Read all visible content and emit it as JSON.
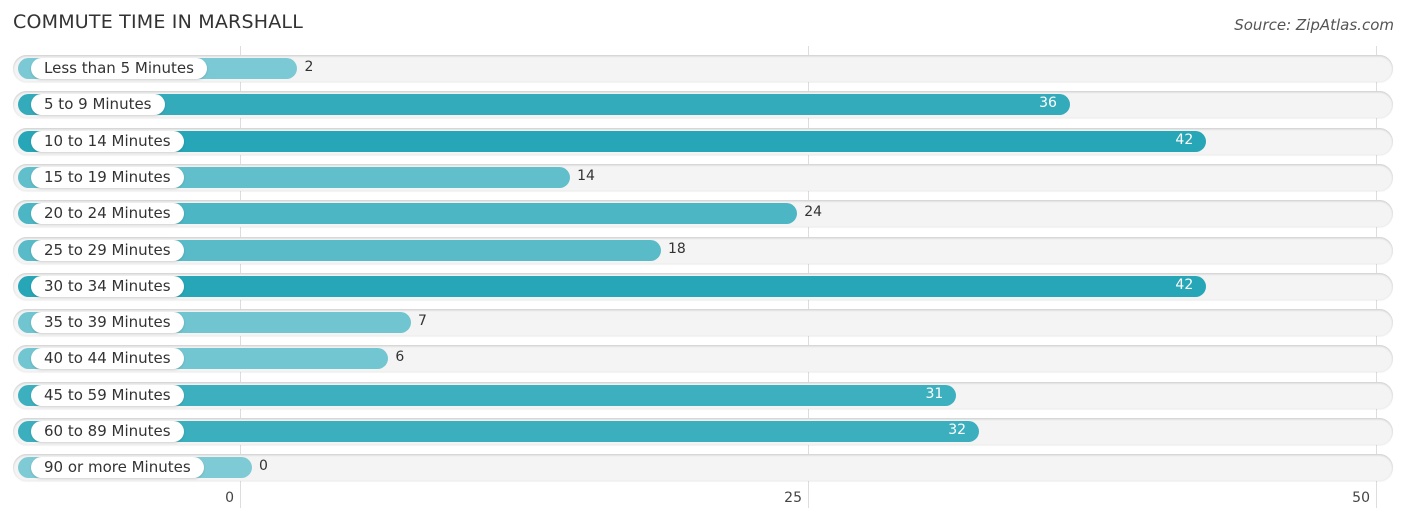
{
  "chart_data": {
    "type": "bar",
    "orientation": "horizontal",
    "title": "COMMUTE TIME IN MARSHALL",
    "source": "Source: ZipAtlas.com",
    "categories": [
      "Less than 5 Minutes",
      "5 to 9 Minutes",
      "10 to 14 Minutes",
      "15 to 19 Minutes",
      "20 to 24 Minutes",
      "25 to 29 Minutes",
      "30 to 34 Minutes",
      "35 to 39 Minutes",
      "40 to 44 Minutes",
      "45 to 59 Minutes",
      "60 to 89 Minutes",
      "90 or more Minutes"
    ],
    "values": [
      2,
      36,
      42,
      14,
      24,
      18,
      42,
      7,
      6,
      31,
      32,
      0
    ],
    "xlim": [
      0,
      50
    ],
    "xticks": [
      "0",
      "25",
      "50"
    ],
    "xtick_values": [
      0,
      25,
      50
    ],
    "xlabel": "",
    "ylabel": "",
    "grid": true,
    "colors": {
      "low": "#7fcbd5",
      "high": "#26a6b7"
    }
  }
}
